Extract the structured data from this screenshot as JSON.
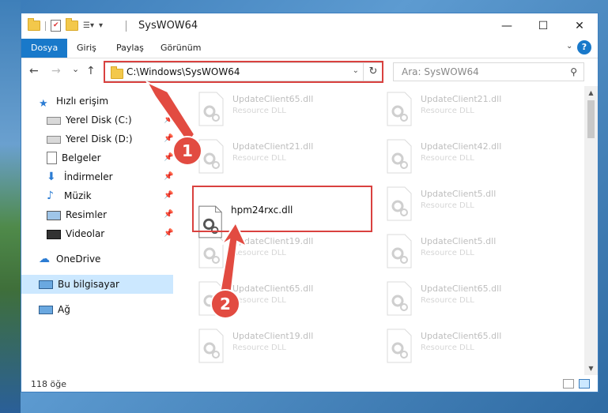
{
  "window": {
    "title": "SysWOW64",
    "controls": {
      "minimize": "—",
      "maximize": "☐",
      "close": "✕"
    }
  },
  "ribbon": {
    "tabs": [
      "Dosya",
      "Giriş",
      "Paylaş",
      "Görünüm"
    ],
    "help": "?"
  },
  "nav": {
    "back": "←",
    "forward": "→",
    "recent": "⌄",
    "up": "↑",
    "address": "C:\\Windows\\SysWOW64",
    "search_placeholder": "Ara: SysWOW64"
  },
  "sidebar": {
    "items": [
      {
        "label": "Hızlı erişim",
        "icon": "star-icon",
        "pinned": false
      },
      {
        "label": "Yerel Disk (C:)",
        "icon": "drive-icon",
        "pinned": true
      },
      {
        "label": "Yerel Disk (D:)",
        "icon": "drive-icon",
        "pinned": true
      },
      {
        "label": "Belgeler",
        "icon": "documents-icon",
        "pinned": true
      },
      {
        "label": "İndirmeler",
        "icon": "download-icon",
        "pinned": true
      },
      {
        "label": "Müzik",
        "icon": "music-icon",
        "pinned": true
      },
      {
        "label": "Resimler",
        "icon": "pictures-icon",
        "pinned": true
      },
      {
        "label": "Videolar",
        "icon": "video-icon",
        "pinned": true
      },
      {
        "label": "OneDrive",
        "icon": "cloud-icon",
        "pinned": false
      },
      {
        "label": "Bu bilgisayar",
        "icon": "computer-icon",
        "pinned": false,
        "selected": true
      },
      {
        "label": "Ağ",
        "icon": "network-icon",
        "pinned": false
      }
    ]
  },
  "files": [
    {
      "name": "UpdateClient65.dll",
      "desc": "Resource DLL"
    },
    {
      "name": "UpdateClient21.dll",
      "desc": "Resource DLL"
    },
    {
      "name": "UpdateClient21.dll",
      "desc": "Resource DLL"
    },
    {
      "name": "UpdateClient42.dll",
      "desc": "Resource DLL"
    },
    {
      "name": "UpdateClient5.dll",
      "desc": "Resource DLL"
    },
    {
      "name": "UpdateClient19.dll",
      "desc": "Resource DLL"
    },
    {
      "name": "UpdateClient5.dll",
      "desc": "Resource DLL"
    },
    {
      "name": "UpdateClient65.dll",
      "desc": "Resource DLL"
    },
    {
      "name": "UpdateClient65.dll",
      "desc": "Resource DLL"
    },
    {
      "name": "UpdateClient19.dll",
      "desc": "Resource DLL"
    },
    {
      "name": "UpdateClient65.dll",
      "desc": "Resource DLL"
    }
  ],
  "focus_file": {
    "name": "hpm24rxc.dll"
  },
  "status": {
    "count": "118 öğe"
  },
  "annotations": {
    "step1": "1",
    "step2": "2"
  },
  "colors": {
    "accent": "#1979ca",
    "annotation_red": "#d9413f",
    "selection": "#cce8ff"
  }
}
